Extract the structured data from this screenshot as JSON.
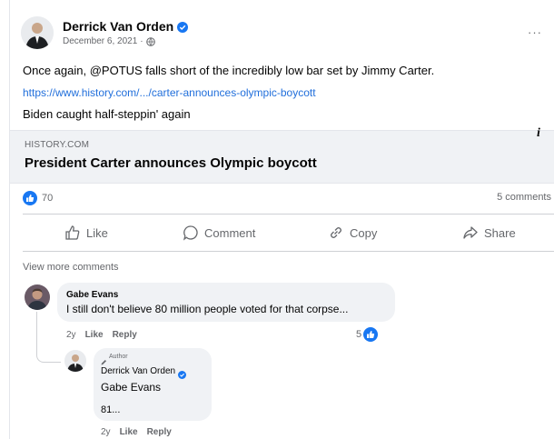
{
  "post": {
    "author": "Derrick Van Orden",
    "date": "December 6, 2021",
    "separator": "·",
    "more_label": "···",
    "text_line1": "Once again, @POTUS falls short of the incredibly low bar set by Jimmy Carter.",
    "link_url": "https://www.history.com/.../carter-announces-olympic-boycott",
    "text_line2": "Biden caught half-steppin' again"
  },
  "link_preview": {
    "domain": "HISTORY.COM",
    "title": "President Carter announces Olympic boycott",
    "info_label": "i"
  },
  "stats": {
    "reactions": "70",
    "comments": "5 comments"
  },
  "actions": {
    "like": "Like",
    "comment": "Comment",
    "copy": "Copy",
    "share": "Share"
  },
  "comments": {
    "view_more": "View more comments",
    "items": [
      {
        "author": "Gabe Evans",
        "text": "I still don't believe 80 million people voted for that corpse...",
        "time": "2y",
        "like": "Like",
        "reply": "Reply",
        "reactions": "5"
      }
    ],
    "reply": {
      "badge": "Author",
      "author": "Derrick Van Orden",
      "mention": "Gabe Evans",
      "text": "81...",
      "time": "2y",
      "like": "Like",
      "reply": "Reply"
    }
  },
  "colors": {
    "accent": "#1877f2",
    "link": "#216fdb",
    "muted": "#65676b",
    "bubble": "#f0f2f5"
  }
}
